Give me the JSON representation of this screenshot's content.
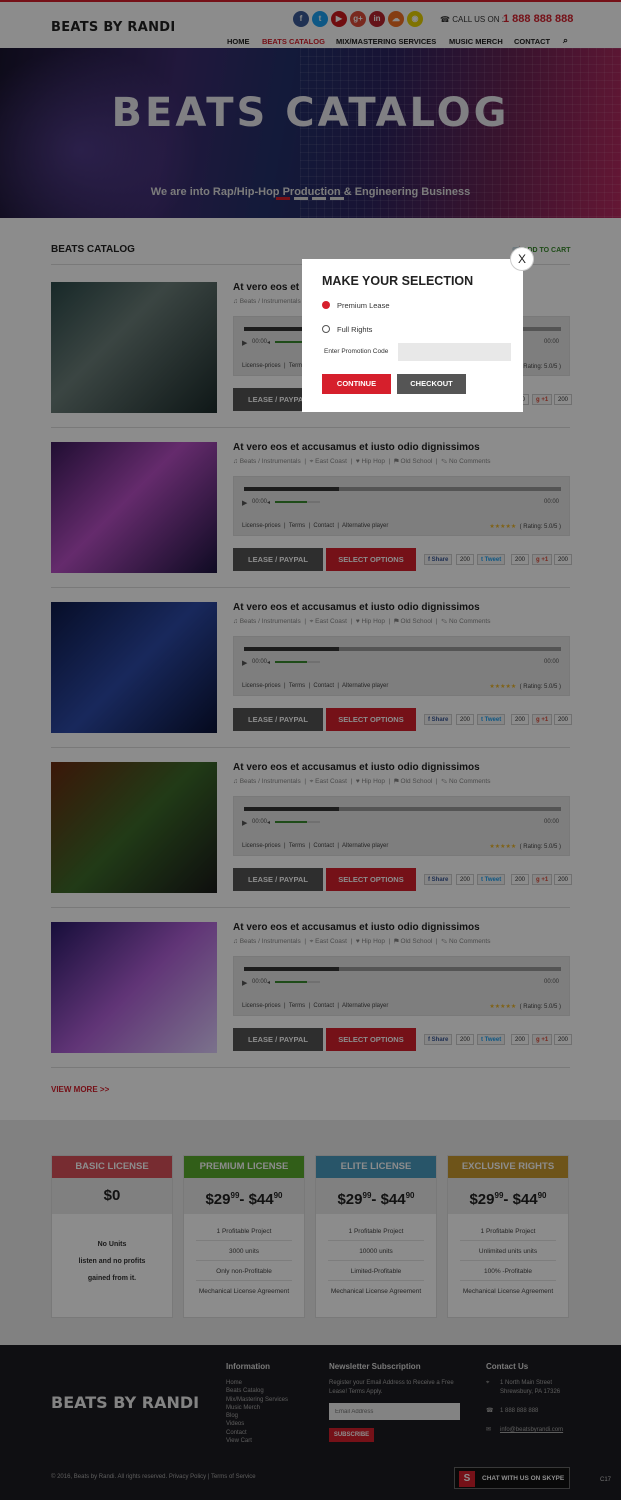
{
  "header": {
    "logo": "BEATS BY RANDI",
    "call_label": "CALL US ON :",
    "phone": "1 888 888 888",
    "social": [
      {
        "icon": "facebook-icon",
        "glyph": "f",
        "color": "#3b5998"
      },
      {
        "icon": "twitter-icon",
        "glyph": "t",
        "color": "#1da1f2"
      },
      {
        "icon": "youtube-icon",
        "glyph": "▶",
        "color": "#cc181e"
      },
      {
        "icon": "googleplus-icon",
        "glyph": "g+",
        "color": "#dd4b39"
      },
      {
        "icon": "linkedin-icon",
        "glyph": "in",
        "color": "#b8232f"
      },
      {
        "icon": "soundcloud-icon",
        "glyph": "☁",
        "color": "#f26f23"
      },
      {
        "icon": "snapchat-icon",
        "glyph": "◉",
        "color": "#e8d100"
      }
    ],
    "nav": [
      "HOME",
      "BEATS CATALOG",
      "MIX/MASTERING SERVICES",
      "MUSIC MERCH",
      "CONTACT"
    ],
    "active_nav": "BEATS CATALOG"
  },
  "hero": {
    "title": "BEATS CATALOG",
    "subtitle": "We are into Rap/Hip-Hop Production & Engineering Business"
  },
  "catalog": {
    "title": "BEATS CATALOG",
    "add_to_cart": "ADD TO CART",
    "items": [
      {
        "title": "At vero eos et accusamus et iusto odio dignissimos",
        "category": "Beats / Instrumentals",
        "location": "East Coast",
        "genre": "Hip Hop",
        "style": "Old School",
        "comments": "No Comments",
        "time_start": "00:00",
        "time_end": "00:00",
        "rating": "( Rating: 5.0/5 )",
        "progress": 0.3
      },
      {
        "title": "At vero eos et accusamus et iusto odio dignissimos",
        "category": "Beats / Instrumentals",
        "location": "East Coast",
        "genre": "Hip Hop",
        "style": "Old School",
        "comments": "No Comments",
        "time_start": "00:00",
        "time_end": "00:00",
        "rating": "( Rating: 5.0/5 )",
        "progress": 0.3
      },
      {
        "title": "At vero eos et accusamus et iusto odio dignissimos",
        "category": "Beats / Instrumentals",
        "location": "East Coast",
        "genre": "Hip Hop",
        "style": "Old School",
        "comments": "No Comments",
        "time_start": "00:00",
        "time_end": "00:00",
        "rating": "( Rating: 5.0/5 )",
        "progress": 0.3
      },
      {
        "title": "At vero eos et accusamus et iusto odio dignissimos",
        "category": "Beats / Instrumentals",
        "location": "East Coast",
        "genre": "Hip Hop",
        "style": "Old School",
        "comments": "No Comments",
        "time_start": "00:00",
        "time_end": "00:00",
        "rating": "( Rating: 5.0/5 )",
        "progress": 0.3
      },
      {
        "title": "At vero eos et accusamus et iusto odio dignissimos",
        "category": "Beats / Instrumentals",
        "location": "East Coast",
        "genre": "Hip Hop",
        "style": "Old School",
        "comments": "No Comments",
        "time_start": "00:00",
        "time_end": "00:00",
        "rating": "( Rating: 5.0/5 )",
        "progress": 0.3
      }
    ],
    "player_links": [
      "License-prices",
      "Terms",
      "Contact",
      "Alternative player"
    ],
    "lease_label": "LEASE / PAYPAL",
    "select_label": "SELECT OPTIONS",
    "share_label": "Share",
    "tweet_label": "Tweet",
    "gplus_label": "+1",
    "share_count": "200",
    "view_more": "VIEW MORE >>"
  },
  "pricing": [
    {
      "name": "BASIC LICENSE",
      "color": "#d9505a",
      "price": "$0",
      "lines": []
    },
    {
      "name": "PREMIUM LICENSE",
      "color": "#5aab2d",
      "price": "$29.99 - $44.90",
      "lines": [
        "1 Profitable Project",
        "3000 units",
        "Only non-Profitable",
        "Mechanical License Agreement"
      ]
    },
    {
      "name": "ELITE LICENSE",
      "color": "#4a9bc0",
      "price": "$29.99 - $44.90",
      "lines": [
        "1 Profitable Project",
        "10000 units",
        "Limited-Profitable",
        "Mechanical License Agreement"
      ]
    },
    {
      "name": "EXCLUSIVE RIGHTS",
      "color": "#c99a2f",
      "price": "$29.99 - $44.90",
      "lines": [
        "1 Profitable Project",
        "Unlimited units units",
        "100% -Profitable",
        "Mechanical License Agreement"
      ]
    }
  ],
  "basic_text": [
    "No Units",
    "listen and no profits",
    "gained from it."
  ],
  "price_parts": {
    "whole_a": "$29",
    "cents_a": "99",
    "whole_b": "- $44",
    "cents_b": "90"
  },
  "footer": {
    "logo": "BEATS BY RANDI",
    "info_title": "Information",
    "info_links": [
      "Home",
      "Beats Catalog",
      "Mix/Mastering Services",
      "Music Merch",
      "Blog",
      "Videos",
      "Contact",
      "View Cart"
    ],
    "newsletter_title": "Newsletter Subscription",
    "newsletter_text": "Register your Email Address to Receive a Free Lease! Terms Apply.",
    "email_placeholder": "Email Address",
    "subscribe": "SUBSCRIBE",
    "contact_title": "Contact Us",
    "address_1": "1 North Main Street",
    "address_2": "Shrewsbury, PA 17326",
    "phone": "1 888 888 888",
    "email": "info@beatsbyrandi.com",
    "copyright": "© 2016, Beats by Randi. All rights reserved.",
    "privacy": "Privacy Policy",
    "terms": "Terms of Service",
    "skype": "CHAT WITH US ON SKYPE",
    "badge": "C17"
  },
  "modal": {
    "title": "MAKE YOUR SELECTION",
    "option_1": "Premium Lease",
    "option_2": "Full Rights",
    "promo_label": "Enter Promotion Code",
    "promo_value": "",
    "continue": "CONTINUE",
    "checkout": "CHECKOUT",
    "close": "X",
    "selected": "Premium Lease"
  }
}
